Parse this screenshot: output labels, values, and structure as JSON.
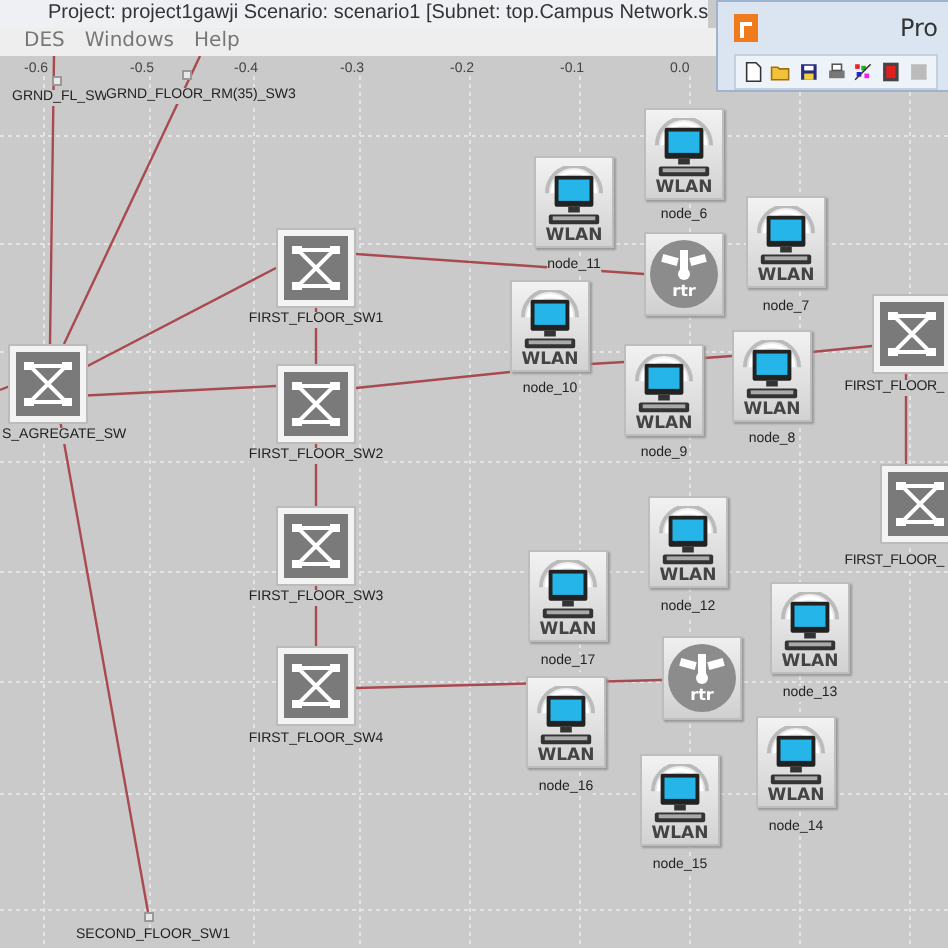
{
  "window": {
    "title": "Project: project1gawji Scenario: scenario1  [Subnet: top.Campus Network.s"
  },
  "menu": [
    "DES",
    "Windows",
    "Help"
  ],
  "ruler": {
    "ticks": [
      "-0.6",
      "-0.5",
      "-0.4",
      "-0.3",
      "-0.2",
      "-0.1",
      "0.0"
    ]
  },
  "toolbar_window": {
    "title": "Pro"
  },
  "nodes": [
    {
      "kind": "point",
      "label": "GRND_FL_SW"
    },
    {
      "kind": "point",
      "label": "GRND_FLOOR_RM(35)_SW3"
    },
    {
      "kind": "switch",
      "label": "S_AGREGATE_SW"
    },
    {
      "kind": "switch",
      "label": "FIRST_FLOOR_SW1"
    },
    {
      "kind": "switch",
      "label": "FIRST_FLOOR_SW2"
    },
    {
      "kind": "switch",
      "label": "FIRST_FLOOR_SW3"
    },
    {
      "kind": "switch",
      "label": "FIRST_FLOOR_SW4"
    },
    {
      "kind": "point",
      "label": "SECOND_FLOOR_SW1"
    },
    {
      "kind": "switch",
      "label": "FIRST_FLOOR_"
    },
    {
      "kind": "switch",
      "label": "FIRST_FLOOR_"
    },
    {
      "kind": "wlan",
      "badge": "WLAN",
      "label": "node_6"
    },
    {
      "kind": "wlan",
      "badge": "WLAN",
      "label": "node_11"
    },
    {
      "kind": "router",
      "badge": "rtr"
    },
    {
      "kind": "wlan",
      "badge": "WLAN",
      "label": "node_7"
    },
    {
      "kind": "wlan",
      "badge": "WLAN",
      "label": "node_10"
    },
    {
      "kind": "wlan",
      "badge": "WLAN",
      "label": "node_9"
    },
    {
      "kind": "wlan",
      "badge": "WLAN",
      "label": "node_8"
    },
    {
      "kind": "wlan",
      "badge": "WLAN",
      "label": "node_12"
    },
    {
      "kind": "wlan",
      "badge": "WLAN",
      "label": "node_17"
    },
    {
      "kind": "router",
      "badge": "rtr"
    },
    {
      "kind": "wlan",
      "badge": "WLAN",
      "label": "node_13"
    },
    {
      "kind": "wlan",
      "badge": "WLAN",
      "label": "node_16"
    },
    {
      "kind": "wlan",
      "badge": "WLAN",
      "label": "node_14"
    },
    {
      "kind": "wlan",
      "badge": "WLAN",
      "label": "node_15"
    }
  ]
}
